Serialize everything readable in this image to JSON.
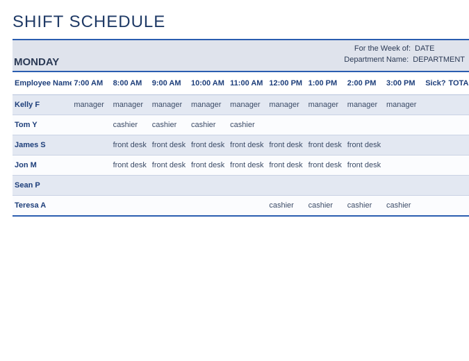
{
  "title": "SHIFT SCHEDULE",
  "day": "MONDAY",
  "meta": {
    "weekLabel": "For the Week of:",
    "weekValue": "DATE",
    "deptLabel": "Department Name:",
    "deptValue": "DEPARTMENT"
  },
  "headers": {
    "employee": "Employee Name",
    "sick": "Sick?",
    "total": "TOTAL",
    "slots": [
      "7:00 AM",
      "8:00 AM",
      "9:00 AM",
      "10:00 AM",
      "11:00 AM",
      "12:00 PM",
      "1:00 PM",
      "2:00 PM",
      "3:00 PM"
    ]
  },
  "rows": [
    {
      "name": "Kelly F",
      "cells": [
        "manager",
        "manager",
        "manager",
        "manager",
        "manager",
        "manager",
        "manager",
        "manager",
        "manager"
      ]
    },
    {
      "name": "Tom Y",
      "cells": [
        "",
        "cashier",
        "cashier",
        "cashier",
        "cashier",
        "",
        "",
        "",
        ""
      ]
    },
    {
      "name": "James S",
      "cells": [
        "",
        "front desk",
        "front desk",
        "front desk",
        "front desk",
        "front desk",
        "front desk",
        "front desk",
        ""
      ]
    },
    {
      "name": "Jon M",
      "cells": [
        "",
        "front desk",
        "front desk",
        "front desk",
        "front desk",
        "front desk",
        "front desk",
        "front desk",
        ""
      ]
    },
    {
      "name": "Sean P",
      "cells": [
        "",
        "",
        "",
        "",
        "",
        "",
        "",
        "",
        ""
      ]
    },
    {
      "name": "Teresa A",
      "cells": [
        "",
        "",
        "",
        "",
        "",
        "cashier",
        "cashier",
        "cashier",
        "cashier"
      ]
    }
  ]
}
